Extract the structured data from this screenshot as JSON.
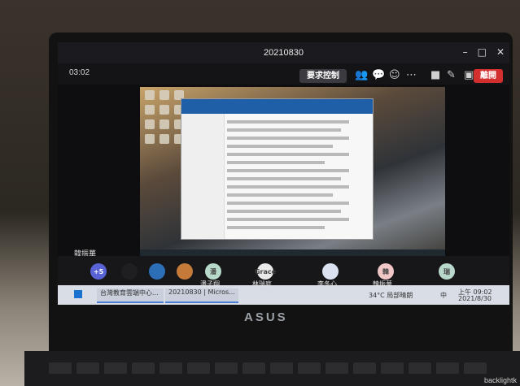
{
  "window": {
    "title": "20210830",
    "minimize": "–",
    "maximize": "□",
    "close": "✕"
  },
  "toolbar": {
    "timer": "03:02",
    "request_control_label": "要求控制",
    "leave_label": "離開",
    "icons": [
      "participants-icon",
      "chat-icon",
      "reactions-icon",
      "more-icon",
      "camera-off-icon",
      "mic-off-icon",
      "share-screen-icon"
    ]
  },
  "shared_screen": {
    "presenter_name": "韓振華"
  },
  "participants": [
    {
      "avatar_text": "+5",
      "color": "#5a63d6",
      "name": ""
    },
    {
      "avatar_text": "",
      "color": "#1f1f22",
      "name": ""
    },
    {
      "avatar_text": "",
      "color": "#2c6fb7",
      "name": ""
    },
    {
      "avatar_text": "",
      "color": "#c57a3a",
      "name": ""
    },
    {
      "avatar_text": "潘",
      "color": "#b7d9c9",
      "name": "潘子翔"
    },
    {
      "avatar_text": "Grace",
      "color": "#e9e9e9",
      "name": "林瑞庭"
    },
    {
      "avatar_text": "",
      "color": "#d9e2ee",
      "name": "李冬心"
    },
    {
      "avatar_text": "韓",
      "color": "#f1c6c6",
      "name": "韓振華"
    },
    {
      "avatar_text": "瑞",
      "color": "#b9d8cc",
      "name": ""
    }
  ],
  "taskbar": {
    "apps": [
      "台灣教育雲端中心...",
      "20210830 | Micros..."
    ],
    "weather": "34°C 局部晴朗",
    "ime": "中",
    "time": "上午 09:02",
    "date": "2021/8/30"
  },
  "device": {
    "brand": "ASUS",
    "watermark": "backlightk"
  }
}
